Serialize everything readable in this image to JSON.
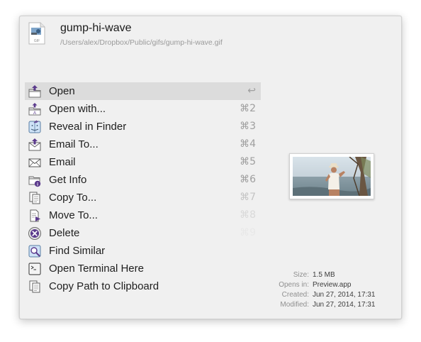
{
  "file": {
    "name": "gump-hi-wave",
    "path": "/Users/alex/Dropbox/Public/gifs/gump-hi-wave.gif",
    "icon": "gif-file-icon",
    "icon_badge": "GIF"
  },
  "actions": [
    {
      "label": "Open",
      "shortcut": "↩",
      "icon": "open-folder-icon"
    },
    {
      "label": "Open with...",
      "shortcut": "⌘2",
      "icon": "open-with-icon"
    },
    {
      "label": "Reveal in Finder",
      "shortcut": "⌘3",
      "icon": "finder-icon"
    },
    {
      "label": "Email To...",
      "shortcut": "⌘4",
      "icon": "email-to-icon"
    },
    {
      "label": "Email",
      "shortcut": "⌘5",
      "icon": "envelope-icon"
    },
    {
      "label": "Get Info",
      "shortcut": "⌘6",
      "icon": "info-icon"
    },
    {
      "label": "Copy To...",
      "shortcut": "⌘7",
      "icon": "copy-icon"
    },
    {
      "label": "Move To...",
      "shortcut": "⌘8",
      "icon": "move-icon"
    },
    {
      "label": "Delete",
      "shortcut": "⌘9",
      "icon": "delete-icon"
    },
    {
      "label": "Find Similar",
      "shortcut": "",
      "icon": "find-similar-icon"
    },
    {
      "label": "Open Terminal Here",
      "shortcut": "",
      "icon": "terminal-icon"
    },
    {
      "label": "Copy Path to Clipboard",
      "shortcut": "",
      "icon": "clipboard-icon"
    }
  ],
  "meta": [
    {
      "label": "Size:",
      "value": "1.5 MB"
    },
    {
      "label": "Opens in:",
      "value": "Preview.app"
    },
    {
      "label": "Created:",
      "value": "Jun 27, 2014, 17:31"
    },
    {
      "label": "Modified:",
      "value": "Jun 27, 2014, 17:31"
    }
  ],
  "colors": {
    "panel_bg": "#f0f0f0",
    "selected_row": "#dcdcdc",
    "icon_purple": "#5b3a8c"
  }
}
